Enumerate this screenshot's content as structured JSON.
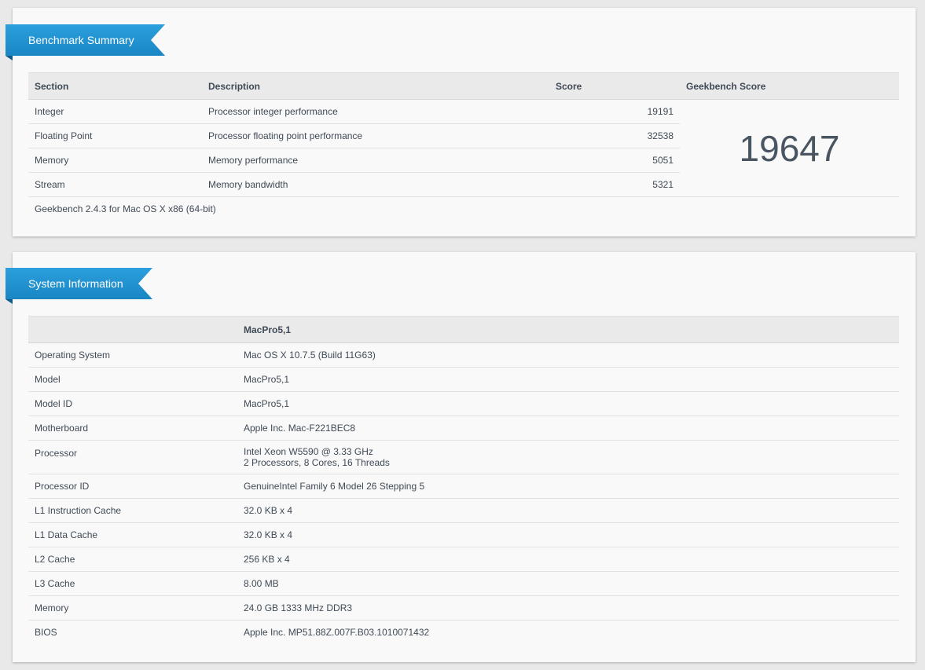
{
  "benchmark": {
    "title": "Benchmark Summary",
    "headers": {
      "section": "Section",
      "description": "Description",
      "score": "Score",
      "geekbench_score": "Geekbench Score"
    },
    "rows": [
      {
        "section": "Integer",
        "description": "Processor integer performance",
        "score": "19191"
      },
      {
        "section": "Floating Point",
        "description": "Processor floating point performance",
        "score": "32538"
      },
      {
        "section": "Memory",
        "description": "Memory performance",
        "score": "5051"
      },
      {
        "section": "Stream",
        "description": "Memory bandwidth",
        "score": "5321"
      }
    ],
    "total_score": "19647",
    "footnote": "Geekbench 2.4.3 for Mac OS X x86 (64-bit)"
  },
  "system": {
    "title": "System Information",
    "header_value": "MacPro5,1",
    "rows": [
      {
        "label": "Operating System",
        "value": "Mac OS X 10.7.5 (Build 11G63)"
      },
      {
        "label": "Model",
        "value": "MacPro5,1"
      },
      {
        "label": "Model ID",
        "value": "MacPro5,1"
      },
      {
        "label": "Motherboard",
        "value": "Apple Inc. Mac-F221BEC8"
      },
      {
        "label": "Processor",
        "value": "Intel Xeon W5590 @ 3.33 GHz",
        "value2": "2 Processors, 8 Cores, 16 Threads"
      },
      {
        "label": "Processor ID",
        "value": "GenuineIntel Family 6 Model 26 Stepping 5"
      },
      {
        "label": "L1 Instruction Cache",
        "value": "32.0 KB x 4"
      },
      {
        "label": "L1 Data Cache",
        "value": "32.0 KB x 4"
      },
      {
        "label": "L2 Cache",
        "value": "256 KB x 4"
      },
      {
        "label": "L3 Cache",
        "value": "8.00 MB"
      },
      {
        "label": "Memory",
        "value": "24.0 GB 1333 MHz DDR3"
      },
      {
        "label": "BIOS",
        "value": "Apple Inc. MP51.88Z.007F.B03.1010071432"
      }
    ]
  },
  "colors": {
    "ribbon": "#1f8fcf",
    "panel": "#f9f9f9",
    "header_row": "#eaeaea",
    "page": "#e9e9e9"
  }
}
